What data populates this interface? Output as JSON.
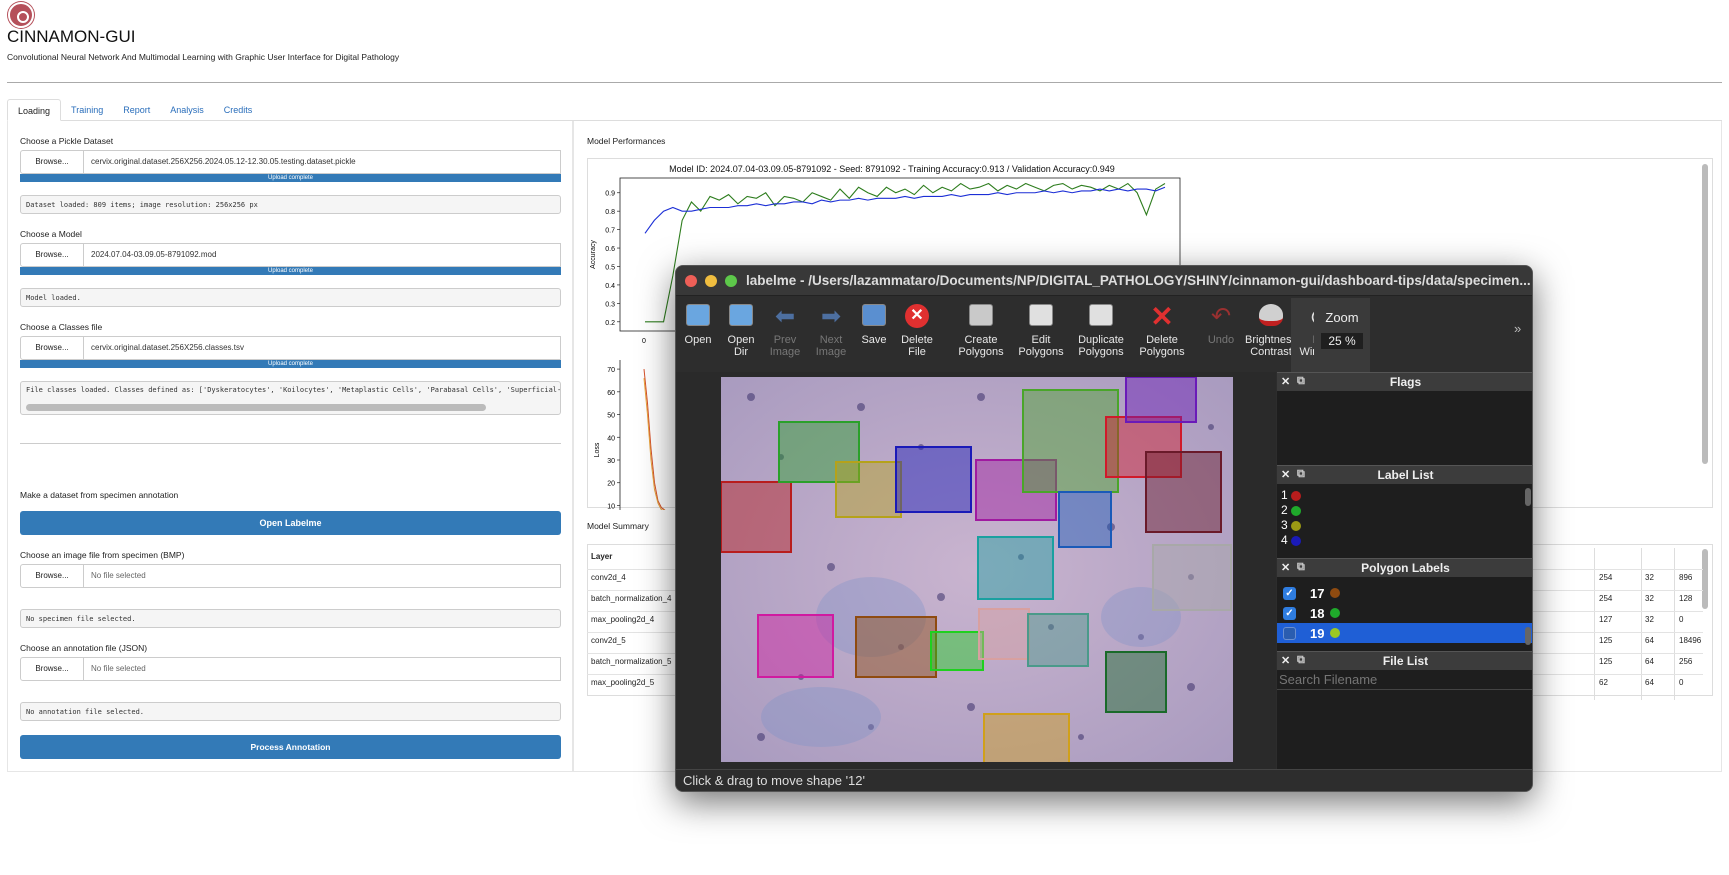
{
  "app": {
    "title": "CINNAMON-GUI",
    "subtitle": "Convolutional Neural Network And Multimodal Learning with Graphic User Interface for Digital Pathology"
  },
  "tabs": [
    "Loading",
    "Training",
    "Report",
    "Analysis",
    "Credits"
  ],
  "loading": {
    "pickle_label": "Choose a Pickle Dataset",
    "pickle_file": "cervix.original.dataset.256X256.2024.05.12-12.30.05.testing.dataset.pickle",
    "browse_label": "Browse...",
    "upload_complete": "Upload complete",
    "dataset_status": "Dataset loaded: 809 items; image resolution: 256x256 px",
    "model_label": "Choose a Model",
    "model_file": "2024.07.04-03.09.05-8791092.mod",
    "model_status": "Model loaded.",
    "classes_label": "Choose a Classes file",
    "classes_file": "cervix.original.dataset.256X256.classes.tsv",
    "classes_status": "File classes loaded. Classes defined as: ['Dyskeratocytes', 'Koilocytes', 'Metaplastic Cells', 'Parabasal Cells', 'Superficial-In",
    "specimen_header": "Make a dataset from specimen annotation",
    "open_labelme": "Open Labelme",
    "image_label": "Choose an image file from specimen (BMP)",
    "image_placeholder": "No file selected",
    "image_status": "No specimen file selected.",
    "annotation_label": "Choose an annotation file (JSON)",
    "annotation_placeholder": "No file selected",
    "annotation_status": "No annotation file selected.",
    "process_annotation": "Process Annotation"
  },
  "performance": {
    "header": "Model Performances",
    "summary_header": "Model Summary"
  },
  "chart_data": [
    {
      "type": "line",
      "title": "Model ID: 2024.07.04-03.09.05-8791092 - Seed: 8791092 - Training Accuracy:0.913 / Validation Accuracy:0.949",
      "ylabel": "Accuracy",
      "xlabel": "",
      "x_tick_labels": [
        "0"
      ],
      "y_tick_labels": [
        "0.2",
        "0.3",
        "0.4",
        "0.5",
        "0.6",
        "0.7",
        "0.8",
        "0.9"
      ],
      "ylim": [
        0.15,
        0.98
      ],
      "series": [
        {
          "color": "#2e7d1e",
          "values": [
            0.2,
            0.2,
            0.2,
            0.45,
            0.75,
            0.85,
            0.8,
            0.88,
            0.86,
            0.89,
            0.84,
            0.88,
            0.87,
            0.9,
            0.83,
            0.88,
            0.87,
            0.85,
            0.9,
            0.88,
            0.86,
            0.92,
            0.87,
            0.93,
            0.9,
            0.88,
            0.93,
            0.9,
            0.92,
            0.89,
            0.94,
            0.9,
            0.93,
            0.91,
            0.95,
            0.92,
            0.93,
            0.95,
            0.91,
            0.94,
            0.92,
            0.95,
            0.93,
            0.91,
            0.94,
            0.95,
            0.92,
            0.94,
            0.93,
            0.91,
            0.94,
            0.92,
            0.95,
            0.9,
            0.78,
            0.92,
            0.95
          ]
        },
        {
          "color": "#1c2fd6",
          "values": [
            0.68,
            0.75,
            0.8,
            0.82,
            0.8,
            0.8,
            0.81,
            0.82,
            0.82,
            0.82,
            0.83,
            0.83,
            0.84,
            0.83,
            0.84,
            0.84,
            0.85,
            0.85,
            0.84,
            0.86,
            0.85,
            0.86,
            0.86,
            0.87,
            0.86,
            0.87,
            0.87,
            0.87,
            0.88,
            0.87,
            0.88,
            0.88,
            0.88,
            0.89,
            0.88,
            0.89,
            0.89,
            0.89,
            0.9,
            0.89,
            0.9,
            0.9,
            0.9,
            0.91,
            0.9,
            0.91,
            0.9,
            0.91,
            0.91,
            0.92,
            0.91,
            0.92,
            0.91,
            0.92,
            0.92,
            0.91,
            0.93
          ]
        }
      ]
    },
    {
      "type": "line",
      "ylabel": "Loss",
      "y_tick_labels": [
        "10",
        "20",
        "30",
        "40",
        "50",
        "60",
        "70"
      ],
      "ylim": [
        8,
        74
      ],
      "series": [
        {
          "color": "#d4502a",
          "values": [
            70,
            55,
            35,
            20,
            12,
            9,
            8
          ]
        },
        {
          "color": "#e8a13a",
          "values": [
            66,
            50,
            30,
            17,
            11,
            8,
            8
          ]
        }
      ]
    }
  ],
  "summary_table": {
    "header": [
      "Layer",
      "",
      "",
      ""
    ],
    "rows": [
      [
        "conv2d_4",
        "254",
        "32",
        "896"
      ],
      [
        "batch_normalization_4",
        "254",
        "32",
        "128"
      ],
      [
        "max_pooling2d_4",
        "127",
        "32",
        "0"
      ],
      [
        "conv2d_5",
        "125",
        "64",
        "18496"
      ],
      [
        "batch_normalization_5",
        "125",
        "64",
        "256"
      ],
      [
        "max_pooling2d_5",
        "62",
        "64",
        "0"
      ]
    ]
  },
  "labelme": {
    "title": "labelme - /Users/lazammataro/Documents/NP/DIGITAL_PATHOLOGY/SHINY/cinnamon-gui/dashboard-tips/data/specimen...",
    "toolbar": [
      {
        "l1": "Open",
        "l2": "",
        "icon": "open-folder-icon",
        "enabled": true
      },
      {
        "l1": "Open",
        "l2": "Dir",
        "icon": "open-dir-icon",
        "enabled": true
      },
      {
        "l1": "Prev",
        "l2": "Image",
        "icon": "prev-arrow-icon",
        "enabled": false
      },
      {
        "l1": "Next",
        "l2": "Image",
        "icon": "next-arrow-icon",
        "enabled": false
      },
      {
        "l1": "Save",
        "l2": "",
        "icon": "save-icon",
        "enabled": true
      },
      {
        "l1": "Delete",
        "l2": "File",
        "icon": "delete-file-icon",
        "enabled": true
      },
      {
        "l1": "Create",
        "l2": "Polygons",
        "icon": "create-polygon-icon",
        "enabled": true
      },
      {
        "l1": "Edit",
        "l2": "Polygons",
        "icon": "edit-polygon-icon",
        "enabled": true
      },
      {
        "l1": "Duplicate",
        "l2": "Polygons",
        "icon": "duplicate-icon",
        "enabled": true
      },
      {
        "l1": "Delete",
        "l2": "Polygons",
        "icon": "delete-polygon-icon",
        "enabled": true
      },
      {
        "l1": "Undo",
        "l2": "",
        "icon": "undo-icon",
        "enabled": false
      },
      {
        "l1": "Brightness",
        "l2": "Contrast",
        "icon": "brightness-icon",
        "enabled": true
      },
      {
        "l1": "Fit",
        "l2": "Window",
        "icon": "fit-window-icon",
        "enabled": true
      }
    ],
    "zoom_label": "Zoom",
    "zoom_value": "25 %",
    "flags_title": "Flags",
    "label_list_title": "Label List",
    "label_list": [
      {
        "label": "1",
        "color": "#b81d1d"
      },
      {
        "label": "2",
        "color": "#1faa2b"
      },
      {
        "label": "3",
        "color": "#9c9a14"
      },
      {
        "label": "4",
        "color": "#1a1ab8"
      }
    ],
    "polygon_labels_title": "Polygon Labels",
    "polygon_labels": [
      {
        "label": "17",
        "color": "#8f4b10",
        "checked": true,
        "selected": false
      },
      {
        "label": "18",
        "color": "#1faa2b",
        "checked": true,
        "selected": false
      },
      {
        "label": "19",
        "color": "#9cc722",
        "checked": false,
        "selected": true
      }
    ],
    "file_list_title": "File List",
    "search_placeholder": "Search Filename",
    "status": "Click & drag to move shape '12'"
  }
}
